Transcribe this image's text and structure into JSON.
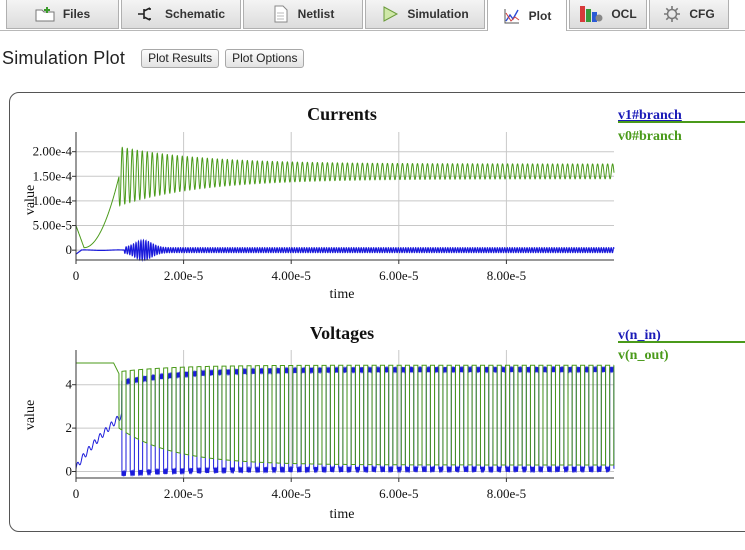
{
  "tabs": [
    {
      "label": "Files",
      "icon": "folder-icon"
    },
    {
      "label": "Schematic",
      "icon": "schematic-icon"
    },
    {
      "label": "Netlist",
      "icon": "document-icon"
    },
    {
      "label": "Simulation",
      "icon": "play-icon"
    },
    {
      "label": "Plot",
      "icon": "plot-icon",
      "active": true
    },
    {
      "label": "OCL",
      "icon": "ocl-icon"
    },
    {
      "label": "CFG",
      "icon": "gear-icon"
    }
  ],
  "header": {
    "title": "Simulation Plot",
    "plot_results_label": "Plot Results",
    "plot_options_label": "Plot Options"
  },
  "chart_data": [
    {
      "type": "line",
      "title": "Currents",
      "xlabel": "time",
      "ylabel": "value",
      "xlim": [
        0,
        0.0001
      ],
      "ylim": [
        -2e-05,
        0.00024
      ],
      "x_ticks": [
        "0",
        "2.00e-5",
        "4.00e-5",
        "6.00e-5",
        "8.00e-5"
      ],
      "y_ticks": [
        "0",
        "5.00e-5",
        "1.00e-4",
        "1.50e-4",
        "2.00e-4"
      ],
      "series": [
        {
          "name": "v1#branch",
          "color": "#1a1adb",
          "baseline": 0,
          "start_level": -8e-06,
          "burst_center": 1.25e-05,
          "burst_amplitude": 1.5e-05,
          "steady_amplitude": 5e-06
        },
        {
          "name": "v0#branch",
          "color": "#4a9a1a",
          "start": 5e-05,
          "dip": 5e-06,
          "rise_end": 8e-06,
          "peak_envelope": 0.00021,
          "steady_center": 0.00016,
          "steady_amplitude": 1.5e-05
        }
      ]
    },
    {
      "type": "line",
      "title": "Voltages",
      "xlabel": "time",
      "ylabel": "value",
      "xlim": [
        0,
        0.0001
      ],
      "ylim": [
        -0.3,
        5.6
      ],
      "x_ticks": [
        "0",
        "2.00e-5",
        "4.00e-5",
        "6.00e-5",
        "8.00e-5"
      ],
      "y_ticks": [
        "0",
        "2",
        "4"
      ],
      "series": [
        {
          "name": "v(n_in)",
          "color": "#1a1adb",
          "low": 0.1,
          "high": 4.7,
          "ramp_end": 8.5e-06
        },
        {
          "name": "v(n_out)",
          "color": "#4a9a1a",
          "low": 0.3,
          "high": 4.9,
          "start": 5.0,
          "switch_start": 8e-06
        }
      ]
    }
  ]
}
